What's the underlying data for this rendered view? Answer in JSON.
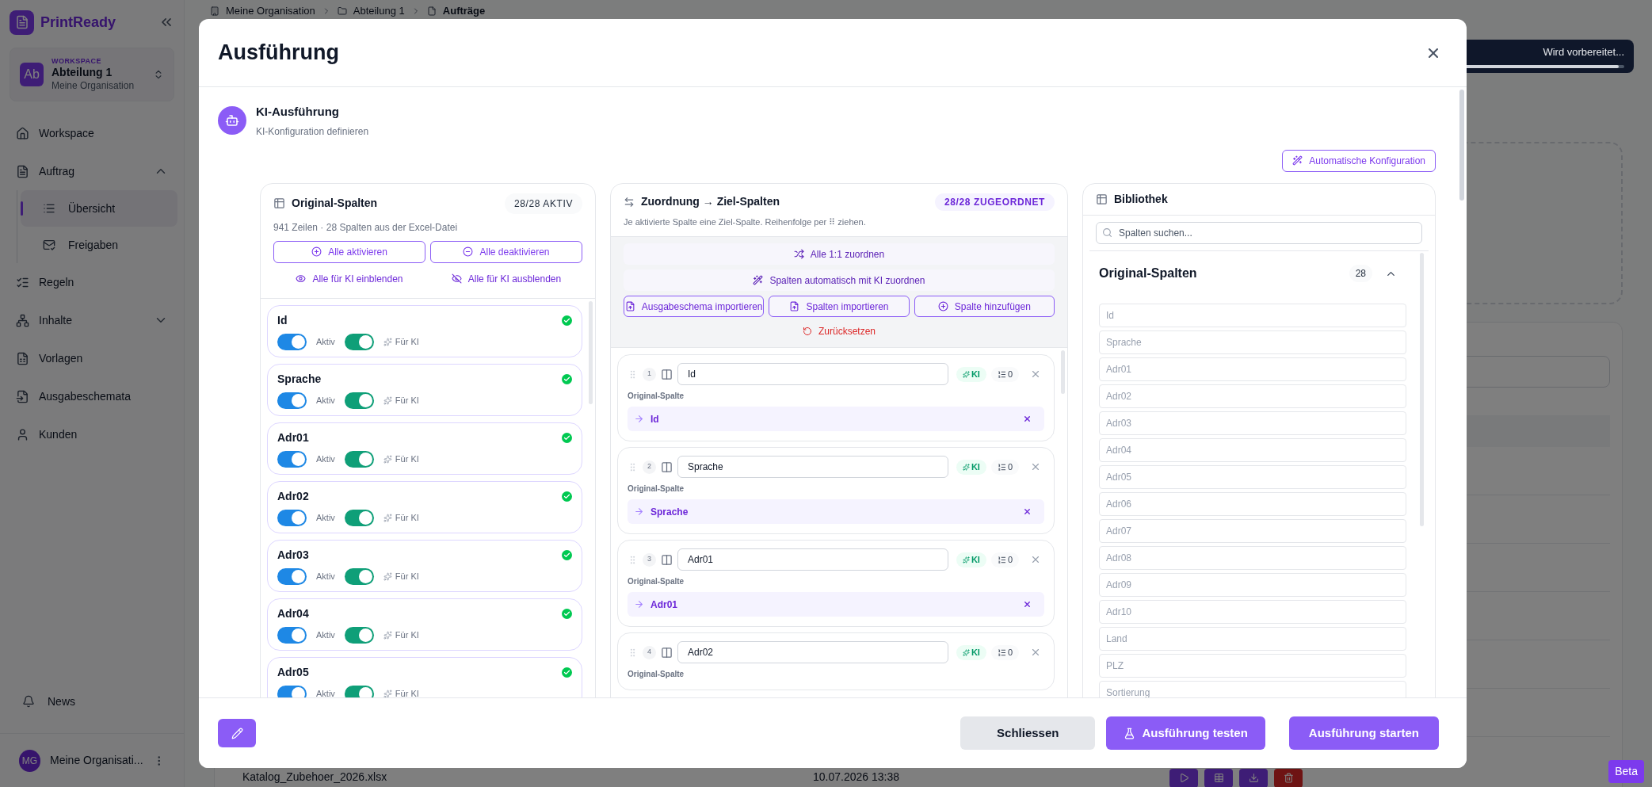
{
  "sidebar": {
    "brand": "PrintReady",
    "workspace": {
      "label": "WORKSPACE",
      "avatar": "Ab",
      "name": "Abteilung 1",
      "org": "Meine Organisation"
    },
    "items": [
      {
        "label": "Workspace",
        "selected": false
      },
      {
        "label": "Auftrag",
        "selected": false,
        "expanded": true,
        "children": [
          {
            "label": "Übersicht",
            "selected": true
          },
          {
            "label": "Freigaben",
            "selected": false
          }
        ]
      },
      {
        "label": "Regeln",
        "selected": false
      },
      {
        "label": "Inhalte",
        "selected": false,
        "expanded": false
      },
      {
        "label": "Vorlagen",
        "selected": false
      },
      {
        "label": "Ausgabeschemata",
        "selected": false
      },
      {
        "label": "Kunden",
        "selected": false
      }
    ],
    "news": "News",
    "user": {
      "initials": "MG",
      "name": "Meine Organisati..."
    }
  },
  "breadcrumb": [
    "Meine Organisation",
    "Abteilung 1",
    "Aufträge"
  ],
  "toast": {
    "text": "Wird vorbereitet...",
    "level": 0.97
  },
  "table": {
    "last_row": {
      "file": "Katalog_Zubehoer_2026.xlsx",
      "date": "10.07.2026 13:38"
    }
  },
  "beta": "Beta",
  "modal": {
    "title": "Ausführung",
    "section": {
      "title": "KI-Ausführung",
      "subtitle": "KI-Konfiguration definieren"
    },
    "auto_button": "Automatische Konfiguration",
    "original": {
      "title": "Original-Spalten",
      "badge": "28/28 AKTIV",
      "subtitle": "941 Zeilen · 28 Spalten aus der Excel-Datei",
      "buttons": [
        "Alle aktivieren",
        "Alle deaktivieren"
      ],
      "links": [
        "Alle für KI einblenden",
        "Alle für KI ausblenden"
      ],
      "rows": [
        {
          "name": "Id",
          "active": true,
          "active_label": "Aktiv",
          "ki": true,
          "ki_label": "Für KI"
        },
        {
          "name": "Sprache",
          "active": true,
          "active_label": "Aktiv",
          "ki": true,
          "ki_label": "Für KI"
        },
        {
          "name": "Adr01",
          "active": true,
          "active_label": "Aktiv",
          "ki": true,
          "ki_label": "Für KI"
        },
        {
          "name": "Adr02",
          "active": true,
          "active_label": "Aktiv",
          "ki": true,
          "ki_label": "Für KI"
        },
        {
          "name": "Adr03",
          "active": true,
          "active_label": "Aktiv",
          "ki": true,
          "ki_label": "Für KI"
        },
        {
          "name": "Adr04",
          "active": true,
          "active_label": "Aktiv",
          "ki": true,
          "ki_label": "Für KI"
        },
        {
          "name": "Adr05",
          "active": true,
          "active_label": "Aktiv",
          "ki": true,
          "ki_label": "Für KI"
        }
      ]
    },
    "mapping": {
      "title": "Zuordnung → Ziel-Spalten",
      "badge": "28/28 ZUGEORDNET",
      "hint": "Je aktivierte Spalte eine Ziel-Spalte. Reihenfolge per ⠿ ziehen.",
      "actions": [
        "Alle 1:1 zuordnen",
        "Spalten automatisch mit KI zuordnen"
      ],
      "imports": [
        "Ausgabeschema importieren",
        "Spalten importieren",
        "Spalte hinzufügen"
      ],
      "reset": "Zurücksetzen",
      "rows": [
        {
          "index": "1",
          "value": "Id",
          "ki": "KI",
          "rules": "0",
          "source_label": "Original-Spalte",
          "source": "Id"
        },
        {
          "index": "2",
          "value": "Sprache",
          "ki": "KI",
          "rules": "0",
          "source_label": "Original-Spalte",
          "source": "Sprache"
        },
        {
          "index": "3",
          "value": "Adr01",
          "ki": "KI",
          "rules": "0",
          "source_label": "Original-Spalte",
          "source": "Adr01"
        },
        {
          "index": "4",
          "value": "Adr02",
          "ki": "KI",
          "rules": "0",
          "source_label": "Original-Spalte"
        }
      ]
    },
    "library": {
      "title": "Bibliothek",
      "search_placeholder": "Spalten suchen...",
      "group": {
        "title": "Original-Spalten",
        "count": "28",
        "expanded": true,
        "items": [
          "Id",
          "Sprache",
          "Adr01",
          "Adr02",
          "Adr03",
          "Adr04",
          "Adr05",
          "Adr06",
          "Adr07",
          "Adr08",
          "Adr09",
          "Adr10",
          "Land",
          "PLZ",
          "Sortierung"
        ]
      }
    },
    "footer": {
      "buttons": [
        {
          "kind": "edit"
        },
        {
          "kind": "secondary",
          "label": "Schliessen"
        },
        {
          "kind": "test",
          "label": "Ausführung testen"
        },
        {
          "kind": "primary",
          "label": "Ausführung starten"
        }
      ]
    }
  }
}
